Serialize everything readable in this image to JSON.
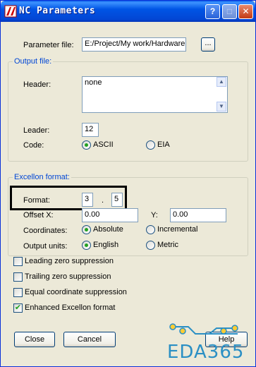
{
  "window": {
    "title": "NC Parameters"
  },
  "parameter_file": {
    "label": "Parameter file:",
    "value": "E:/Project/My work/Hardware",
    "browse_label": "..."
  },
  "output_file": {
    "title": "Output file:",
    "header_label": "Header:",
    "header_value": "none",
    "leader_label": "Leader:",
    "leader_value": "12",
    "code_label": "Code:",
    "code_ascii": "ASCII",
    "code_eia": "EIA",
    "code_selected": "ASCII"
  },
  "excellon": {
    "title": "Excellon format:",
    "format_label": "Format:",
    "format_int": "3",
    "format_sep": ".",
    "format_dec": "5",
    "offset_x_label": "Offset X:",
    "offset_x_value": "0.00",
    "offset_y_label": "Y:",
    "offset_y_value": "0.00",
    "coordinates_label": "Coordinates:",
    "coord_absolute": "Absolute",
    "coord_incremental": "Incremental",
    "coord_selected": "Absolute",
    "units_label": "Output units:",
    "units_english": "English",
    "units_metric": "Metric",
    "units_selected": "English"
  },
  "options": [
    {
      "label": "Leading zero suppression",
      "checked": false
    },
    {
      "label": "Trailing zero suppression",
      "checked": false
    },
    {
      "label": "Equal coordinate suppression",
      "checked": false
    },
    {
      "label": "Enhanced Excellon format",
      "checked": true
    }
  ],
  "buttons": {
    "close": "Close",
    "cancel": "Cancel",
    "help": "Help"
  },
  "watermark": {
    "text": "EDA365"
  },
  "colors": {
    "group_title": "#0046d5",
    "titlebar": "#0055e5",
    "radio_dot": "#21a121",
    "watermark": "#2a8fc4"
  }
}
